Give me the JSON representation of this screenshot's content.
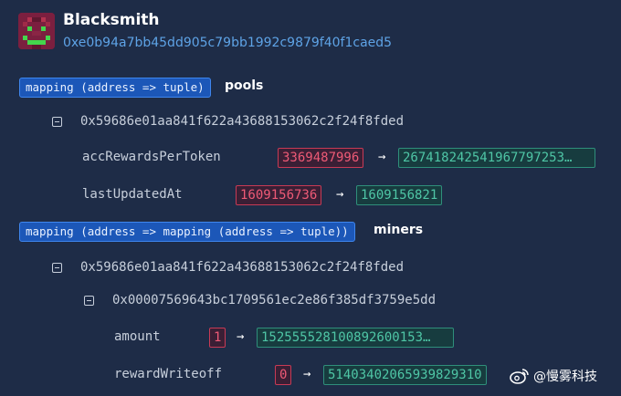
{
  "contract": {
    "name": "Blacksmith",
    "address": "0xe0b94a7bb45dd905c79bb1992c9879f40f1caed5"
  },
  "pools": {
    "type": "mapping (address => tuple)",
    "name": "pools",
    "key": "0x59686e01aa841f622a43688153062c2f24f8fded",
    "fields": [
      {
        "name": "accRewardsPerToken",
        "old": "3369487996",
        "new": "267418242541967797253…"
      },
      {
        "name": "lastUpdatedAt",
        "old": "1609156736",
        "new": "1609156821"
      }
    ]
  },
  "miners": {
    "type": "mapping (address => mapping (address => tuple))",
    "name": "miners",
    "key": "0x59686e01aa841f622a43688153062c2f24f8fded",
    "subkey": "0x00007569643bc1709561ec2e86f385df3759e5dd",
    "fields": [
      {
        "name": "amount",
        "old": "1",
        "new": "152555528100892600153…"
      },
      {
        "name": "rewardWriteoff",
        "old": "0",
        "new": "51403402065939829310"
      }
    ]
  },
  "arrow_glyph": "→",
  "watermark": {
    "text": "@慢雾科技",
    "icon": "weibo-icon"
  },
  "colors": {
    "background": "#1e2c47",
    "type_badge": "#1c57b8",
    "old_value": "#ee5a76",
    "new_value": "#4fc6a6",
    "address_link": "#5ea3e6"
  }
}
